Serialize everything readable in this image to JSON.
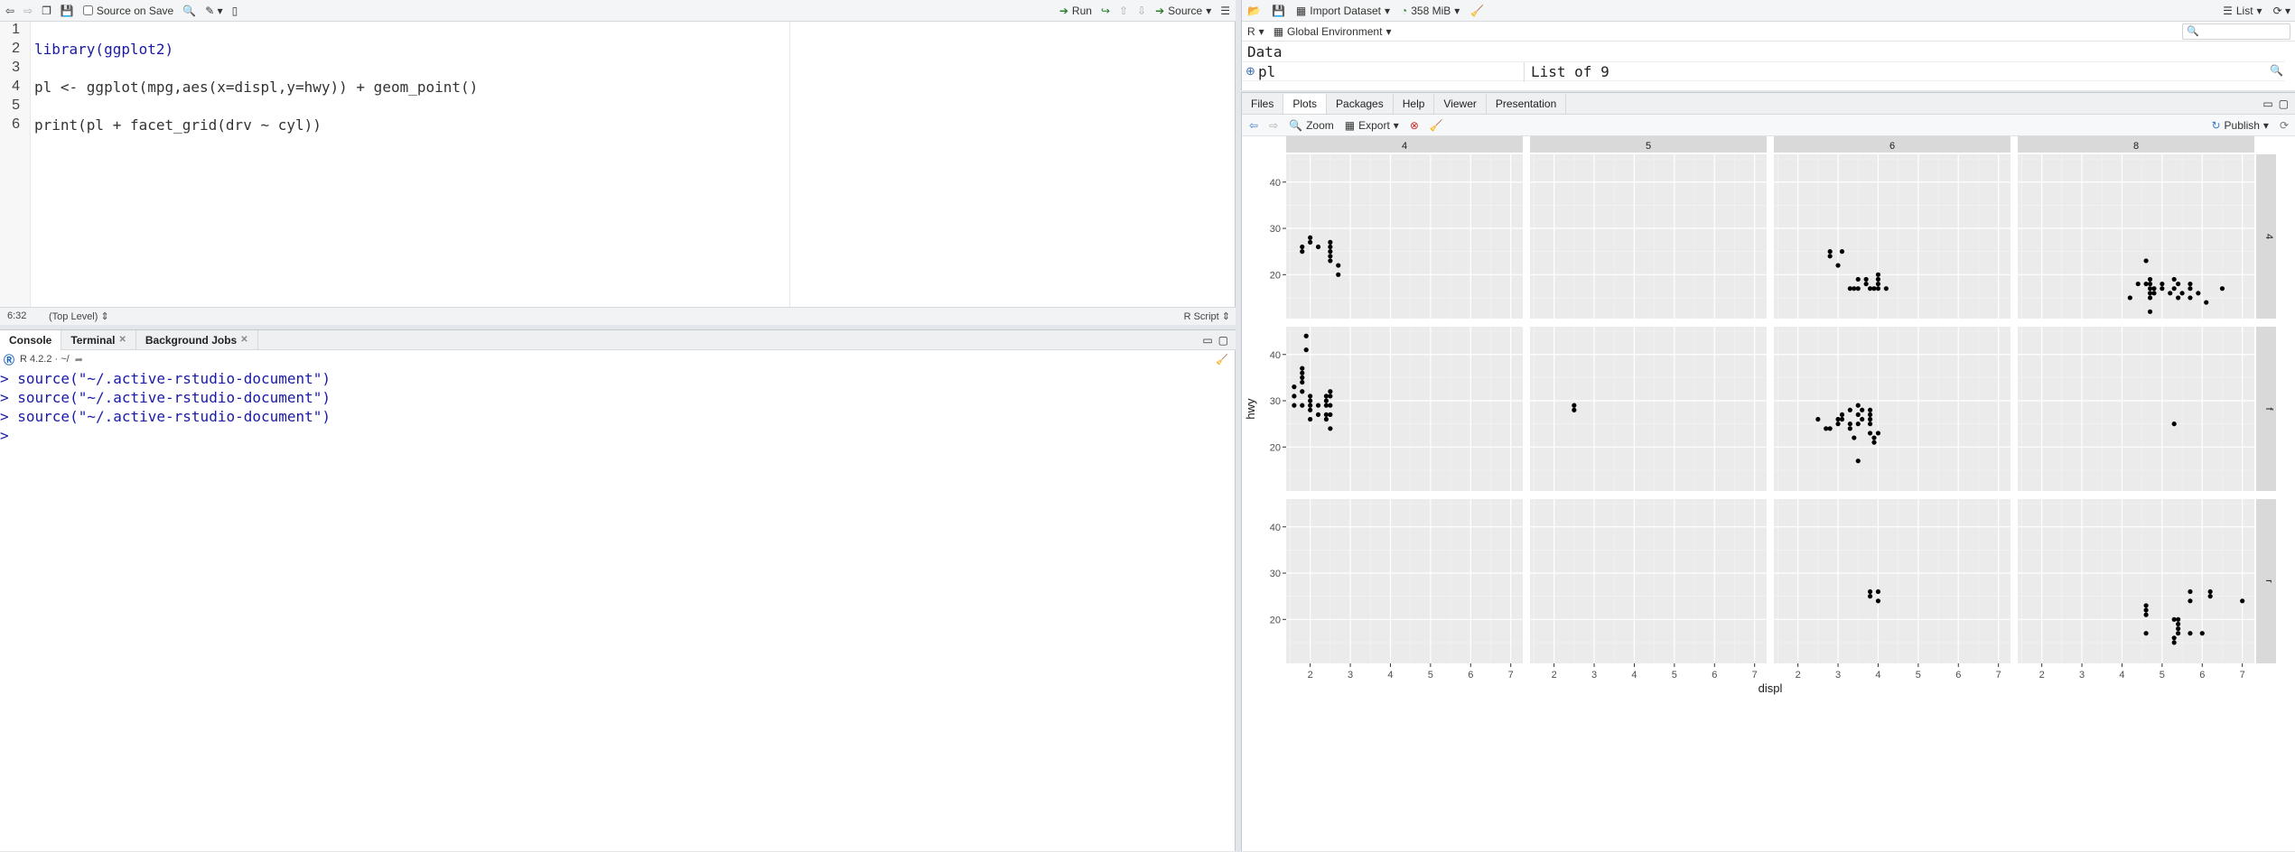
{
  "editor": {
    "toolbar": {
      "source_on_save": "Source on Save",
      "run": "Run",
      "source": "Source"
    },
    "line_numbers": [
      "1",
      "2",
      "3",
      "4",
      "5",
      "6"
    ],
    "code_lines": [
      "",
      "library(ggplot2)",
      "",
      "pl <- ggplot(mpg,aes(x=displ,y=hwy)) + geom_point()",
      "",
      "print(pl + facet_grid(drv ~ cyl))"
    ],
    "status": {
      "position": "6:32",
      "scope": "(Top Level)",
      "file_type": "R Script"
    }
  },
  "console": {
    "tabs": [
      {
        "label": "Console"
      },
      {
        "label": "Terminal"
      },
      {
        "label": "Background Jobs"
      }
    ],
    "r_version": "R 4.2.2 · ~/",
    "lines": [
      "> source(\"~/.active-rstudio-document\")",
      "> source(\"~/.active-rstudio-document\")",
      "> source(\"~/.active-rstudio-document\")",
      "> "
    ]
  },
  "environment": {
    "toolbar": {
      "import_dataset": "Import Dataset",
      "memory": "358 MiB",
      "view_mode": "List"
    },
    "language": "R",
    "scope": "Global Environment",
    "section_title": "Data",
    "row": {
      "name": "pl",
      "value": "List of  9"
    }
  },
  "files_pane": {
    "tabs": [
      {
        "label": "Files"
      },
      {
        "label": "Plots"
      },
      {
        "label": "Packages"
      },
      {
        "label": "Help"
      },
      {
        "label": "Viewer"
      },
      {
        "label": "Presentation"
      }
    ],
    "toolbar": {
      "zoom": "Zoom",
      "export": "Export",
      "publish": "Publish"
    }
  },
  "chart_data": {
    "type": "scatter",
    "xlabel": "displ",
    "ylabel": "hwy",
    "col_facets": [
      "4",
      "5",
      "6",
      "8"
    ],
    "row_facets": [
      "4",
      "f",
      "r"
    ],
    "xlim": [
      1.4,
      7.3
    ],
    "ylim": [
      10.5,
      46
    ],
    "x_ticks": [
      2,
      3,
      4,
      5,
      6,
      7
    ],
    "y_ticks": [
      20,
      30,
      40
    ],
    "panels": [
      {
        "row": "4",
        "col": "4",
        "points": [
          [
            1.8,
            25
          ],
          [
            1.8,
            26
          ],
          [
            2.0,
            28
          ],
          [
            2.0,
            27
          ],
          [
            2.2,
            26
          ],
          [
            2.5,
            27
          ],
          [
            2.5,
            26
          ],
          [
            2.5,
            25
          ],
          [
            2.5,
            24
          ],
          [
            2.5,
            23
          ],
          [
            2.7,
            22
          ],
          [
            2.7,
            20
          ]
        ]
      },
      {
        "row": "4",
        "col": "5",
        "points": []
      },
      {
        "row": "4",
        "col": "6",
        "points": [
          [
            2.8,
            25
          ],
          [
            2.8,
            24
          ],
          [
            3.0,
            22
          ],
          [
            3.1,
            25
          ],
          [
            3.3,
            17
          ],
          [
            3.4,
            17
          ],
          [
            3.5,
            17
          ],
          [
            3.5,
            19
          ],
          [
            3.7,
            19
          ],
          [
            3.7,
            18
          ],
          [
            3.8,
            17
          ],
          [
            3.9,
            17
          ],
          [
            4.0,
            17
          ],
          [
            4.0,
            18
          ],
          [
            4.0,
            19
          ],
          [
            4.0,
            20
          ],
          [
            4.2,
            17
          ]
        ]
      },
      {
        "row": "4",
        "col": "8",
        "points": [
          [
            4.2,
            15
          ],
          [
            4.4,
            18
          ],
          [
            4.6,
            18
          ],
          [
            4.6,
            23
          ],
          [
            4.7,
            17
          ],
          [
            4.7,
            18
          ],
          [
            4.7,
            16
          ],
          [
            4.7,
            15
          ],
          [
            4.7,
            19
          ],
          [
            4.7,
            12
          ],
          [
            4.8,
            16
          ],
          [
            4.8,
            17
          ],
          [
            5.0,
            17
          ],
          [
            5.0,
            18
          ],
          [
            5.2,
            16
          ],
          [
            5.3,
            17
          ],
          [
            5.3,
            19
          ],
          [
            5.4,
            18
          ],
          [
            5.4,
            15
          ],
          [
            5.5,
            16
          ],
          [
            5.7,
            17
          ],
          [
            5.7,
            18
          ],
          [
            5.7,
            15
          ],
          [
            5.9,
            16
          ],
          [
            6.1,
            14
          ],
          [
            6.5,
            17
          ]
        ]
      },
      {
        "row": "f",
        "col": "4",
        "points": [
          [
            1.6,
            29
          ],
          [
            1.6,
            31
          ],
          [
            1.6,
            33
          ],
          [
            1.8,
            29
          ],
          [
            1.8,
            32
          ],
          [
            1.8,
            34
          ],
          [
            1.8,
            35
          ],
          [
            1.8,
            36
          ],
          [
            1.8,
            37
          ],
          [
            1.9,
            41
          ],
          [
            1.9,
            44
          ],
          [
            2.0,
            26
          ],
          [
            2.0,
            28
          ],
          [
            2.0,
            29
          ],
          [
            2.0,
            30
          ],
          [
            2.0,
            31
          ],
          [
            2.2,
            27
          ],
          [
            2.2,
            29
          ],
          [
            2.4,
            26
          ],
          [
            2.4,
            27
          ],
          [
            2.4,
            29
          ],
          [
            2.4,
            30
          ],
          [
            2.4,
            31
          ],
          [
            2.5,
            24
          ],
          [
            2.5,
            27
          ],
          [
            2.5,
            29
          ],
          [
            2.5,
            31
          ],
          [
            2.5,
            32
          ]
        ]
      },
      {
        "row": "f",
        "col": "5",
        "points": [
          [
            2.5,
            28
          ],
          [
            2.5,
            29
          ]
        ]
      },
      {
        "row": "f",
        "col": "6",
        "points": [
          [
            2.5,
            26
          ],
          [
            2.7,
            24
          ],
          [
            2.8,
            24
          ],
          [
            3.0,
            25
          ],
          [
            3.0,
            26
          ],
          [
            3.1,
            26
          ],
          [
            3.1,
            27
          ],
          [
            3.3,
            24
          ],
          [
            3.3,
            25
          ],
          [
            3.3,
            28
          ],
          [
            3.4,
            22
          ],
          [
            3.5,
            17
          ],
          [
            3.5,
            25
          ],
          [
            3.5,
            27
          ],
          [
            3.5,
            29
          ],
          [
            3.6,
            26
          ],
          [
            3.6,
            28
          ],
          [
            3.8,
            23
          ],
          [
            3.8,
            25
          ],
          [
            3.8,
            26
          ],
          [
            3.8,
            27
          ],
          [
            3.8,
            28
          ],
          [
            3.9,
            21
          ],
          [
            3.9,
            22
          ],
          [
            4.0,
            23
          ]
        ]
      },
      {
        "row": "f",
        "col": "8",
        "points": [
          [
            5.3,
            25
          ]
        ]
      },
      {
        "row": "r",
        "col": "4",
        "points": []
      },
      {
        "row": "r",
        "col": "5",
        "points": []
      },
      {
        "row": "r",
        "col": "6",
        "points": [
          [
            3.8,
            26
          ],
          [
            3.8,
            25
          ],
          [
            4.0,
            24
          ],
          [
            4.0,
            26
          ]
        ]
      },
      {
        "row": "r",
        "col": "8",
        "points": [
          [
            4.6,
            17
          ],
          [
            4.6,
            21
          ],
          [
            4.6,
            22
          ],
          [
            4.6,
            23
          ],
          [
            5.3,
            15
          ],
          [
            5.3,
            16
          ],
          [
            5.3,
            20
          ],
          [
            5.4,
            17
          ],
          [
            5.4,
            18
          ],
          [
            5.4,
            19
          ],
          [
            5.4,
            20
          ],
          [
            5.7,
            17
          ],
          [
            5.7,
            24
          ],
          [
            5.7,
            26
          ],
          [
            6.0,
            17
          ],
          [
            6.2,
            25
          ],
          [
            6.2,
            26
          ],
          [
            7.0,
            24
          ]
        ]
      }
    ]
  }
}
